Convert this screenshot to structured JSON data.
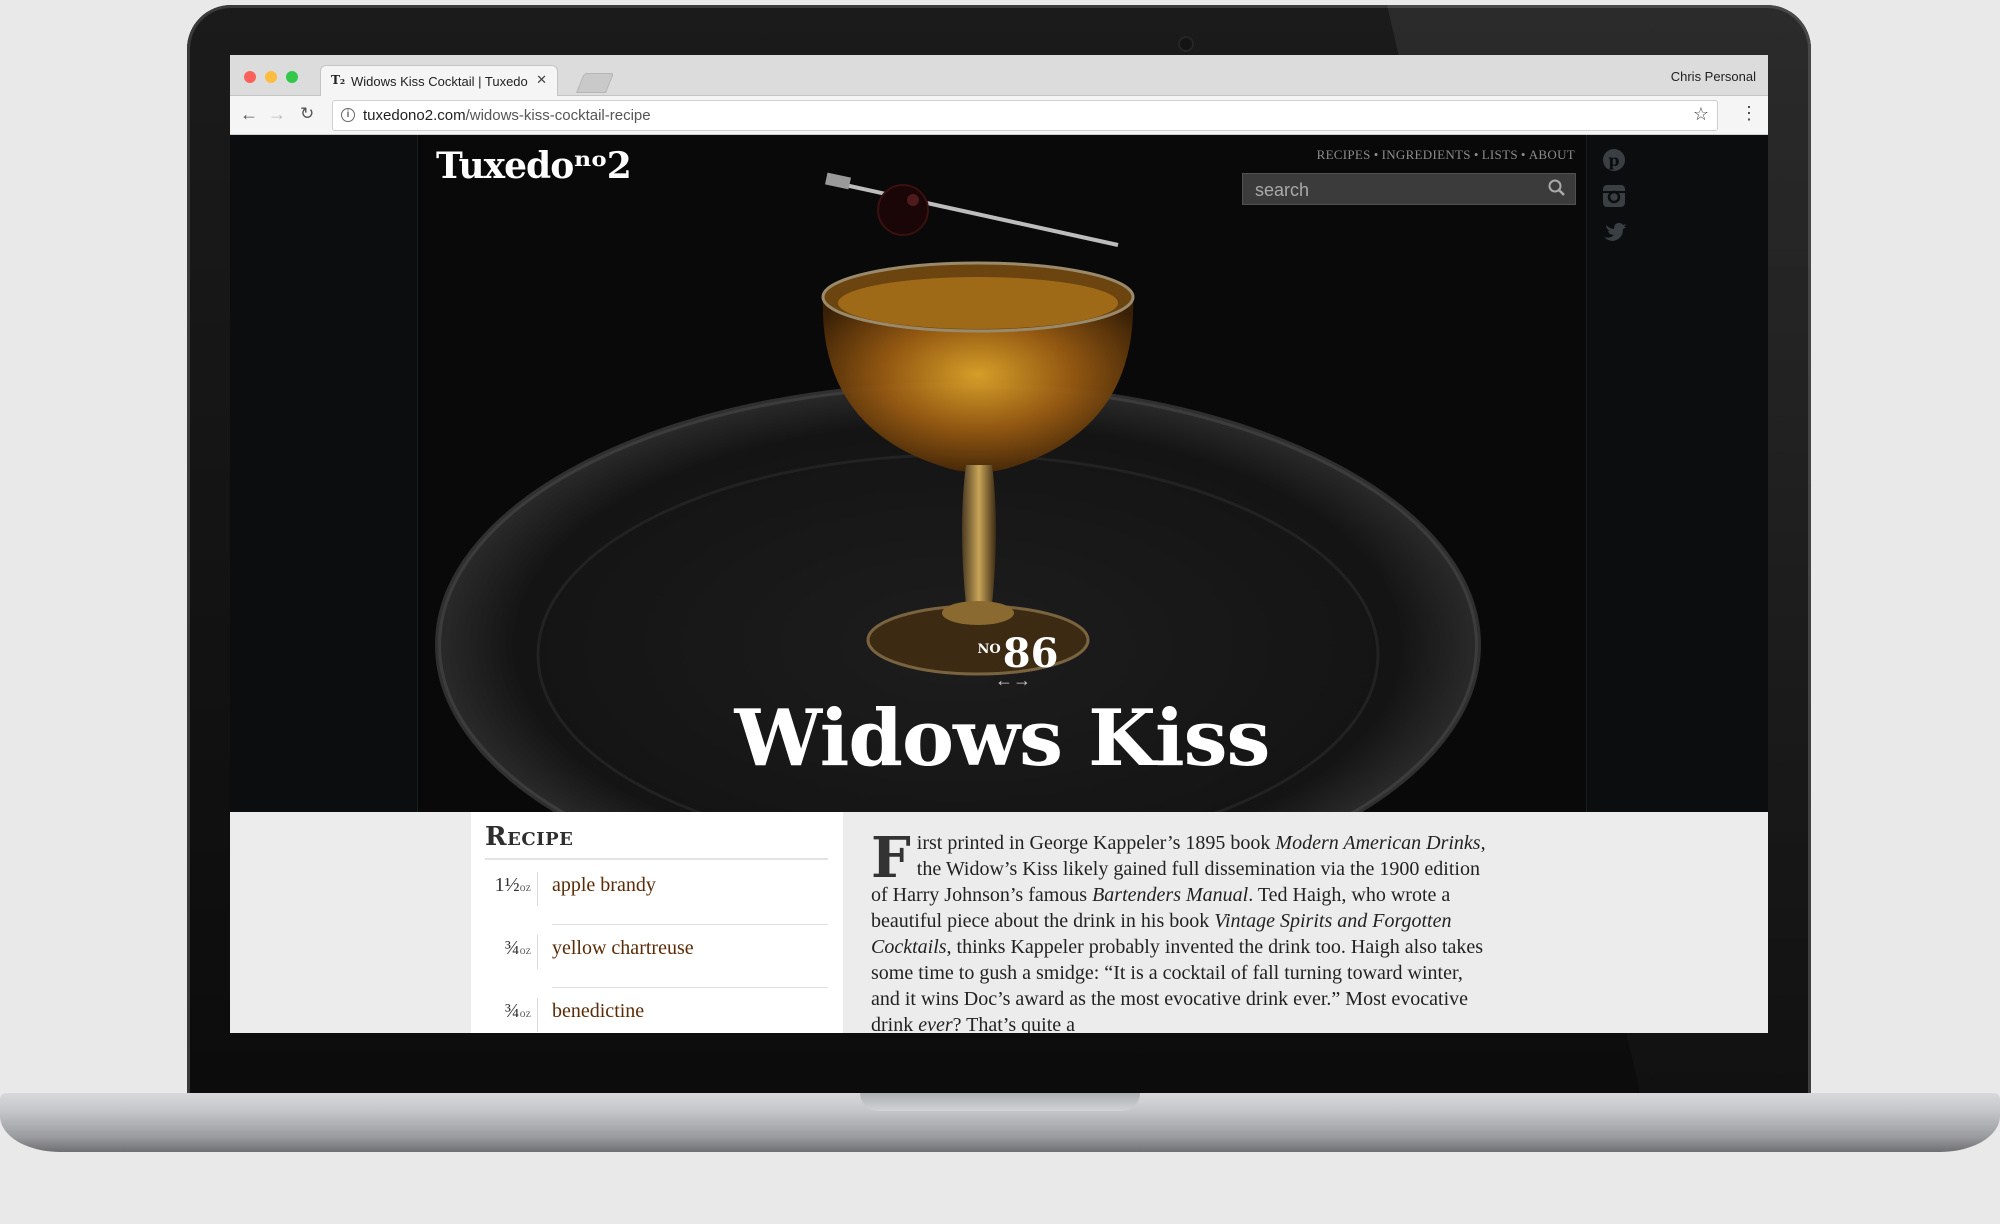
{
  "browser": {
    "tab_title": "Widows Kiss Cocktail | Tuxedo",
    "tab_favicon": "Tuxedo-monogram-icon",
    "profile_name": "Chris Personal",
    "url_domain": "tuxedono2.com",
    "url_path": "/widows-kiss-cocktail-recipe"
  },
  "site": {
    "logo": "Tuxedoⁿᵒ2",
    "nav": [
      "RECIPES",
      "INGREDIENTS",
      "LISTS",
      "ABOUT"
    ],
    "search_placeholder": "search",
    "social": [
      "pinterest-icon",
      "instagram-icon",
      "twitter-icon"
    ]
  },
  "hero": {
    "issue_prefix": "NO",
    "issue_number": "86",
    "title": "Widows Kiss"
  },
  "recipe": {
    "heading": "Recipe",
    "ingredients": [
      {
        "amount": "1½",
        "unit": "oz",
        "name": "apple brandy"
      },
      {
        "amount": "¾",
        "unit": "oz",
        "name": "yellow chartreuse"
      },
      {
        "amount": "¾",
        "unit": "oz",
        "name": "benedictine"
      }
    ]
  },
  "article": {
    "dropcap": "F",
    "p1": "irst printed in George Kappeler’s 1895 book ",
    "i1": "Modern American Drinks",
    "p2": ", the Widow’s Kiss likely gained full dissemination via the 1900 edition of Harry Johnson’s famous ",
    "i2": "Bartenders Manual",
    "p3": ". Ted Haigh, who wrote a beautiful piece about the drink in his book ",
    "i3": "Vintage Spirits and Forgotten Cocktails",
    "p4": ", thinks Kappeler probably invented the drink too. Haigh also takes some time to gush a smidge: “It is a cocktail of fall turning toward winter, and it wins Doc’s award as the most evocative drink ever.” Most evocative drink ",
    "i4": "ever",
    "p5": "? That’s quite a"
  },
  "colors": {
    "ingredient_link": "#5a2b06",
    "page_bg": "#0b0d0f",
    "hero_text": "#ffffff"
  }
}
